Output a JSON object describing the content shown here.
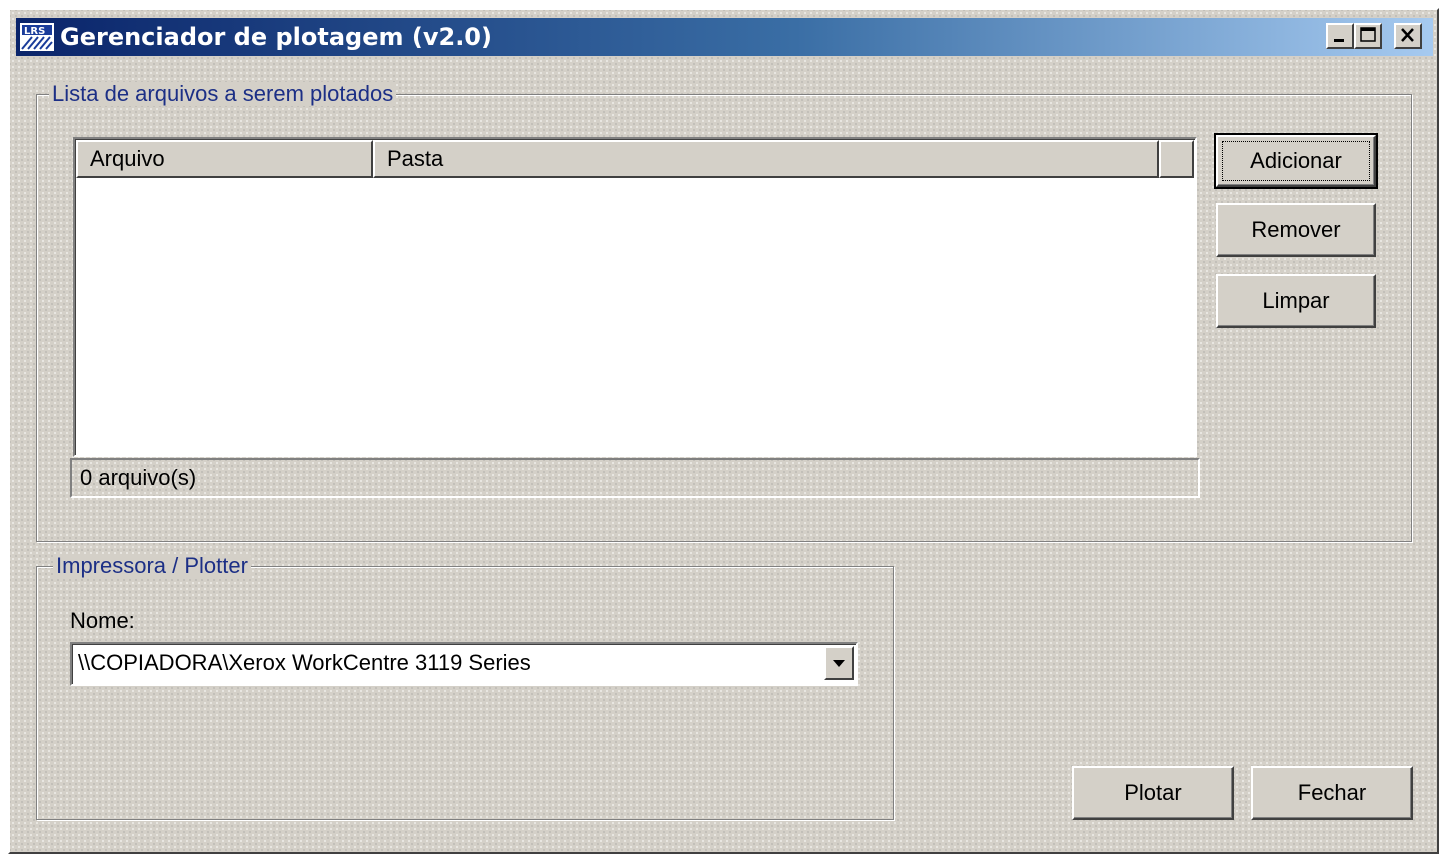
{
  "window": {
    "title": "Gerenciador de plotagem (v2.0)",
    "icon": "app-logo-icon",
    "controls": [
      "minimize-icon",
      "maximize-icon",
      "close-icon"
    ]
  },
  "files_group": {
    "label": "Lista de arquivos a serem plotados",
    "columns": [
      "Arquivo",
      "Pasta"
    ],
    "rows": [],
    "status": "0 arquivo(s)",
    "buttons": {
      "add": "Adicionar",
      "remove": "Remover",
      "clear": "Limpar"
    }
  },
  "printer_group": {
    "label": "Impressora / Plotter",
    "name_label": "Nome:",
    "selected_printer": "\\\\COPIADORA\\Xerox WorkCentre 3119 Series"
  },
  "footer": {
    "plot": "Plotar",
    "close": "Fechar"
  },
  "colors": {
    "title_gradient_start": "#0a246a",
    "title_gradient_end": "#a6caf0",
    "group_label": "#1c2f86",
    "face": "#d4d0c8"
  }
}
